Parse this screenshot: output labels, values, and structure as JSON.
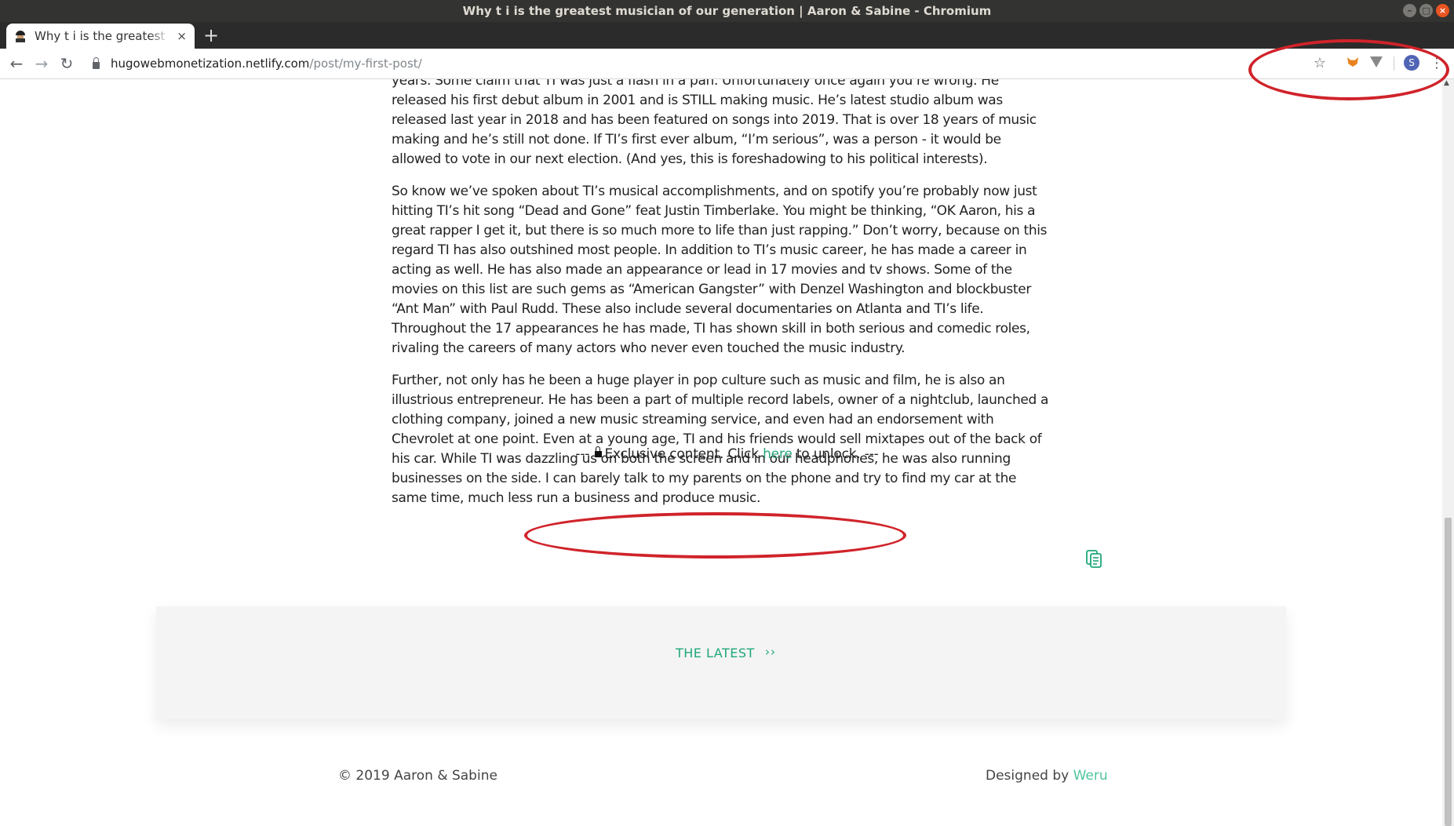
{
  "window": {
    "title": "Why t i is the greatest musician of our generation | Aaron & Sabine - Chromium",
    "controls": [
      "–",
      "□",
      "×"
    ]
  },
  "tab": {
    "title": "Why t i is the greatest musician of our generation | Aaron & Sabine",
    "close": "×",
    "new_tab": "+"
  },
  "toolbar": {
    "back": "←",
    "forward": "→",
    "reload": "↻",
    "url_host": "hugowebmonetization.netlify.com",
    "url_path": "/post/my-first-post/",
    "bookmark_star": "☆",
    "profile_initial": "S",
    "menu": "⋮"
  },
  "article": {
    "paragraphs": [
      "years. Some claim that TI was just a flash in a pan. Unfortunately once again you’re wrong. He released his first debut album in 2001 and is STILL making music. He’s latest studio album was released last year in 2018 and has been featured on songs into 2019. That is over 18 years of music making and he’s still not done. If TI’s first ever album, “I’m serious”, was a person - it would be allowed to vote in our next election. (And yes, this is foreshadowing to his political interests).",
      "So know we’ve spoken about TI’s musical accomplishments, and on spotify you’re probably now just hitting TI’s hit song “Dead and Gone” feat Justin Timberlake. You might be thinking, “OK Aaron, his a great rapper I get it, but there is so much more to life than just rapping.” Don’t worry, because on this regard TI has also outshined most people. In addition to TI’s music career, he has made a career in acting as well. He has also made an appearance or lead in 17 movies and tv shows. Some of the movies on this list are such gems as “American Gangster” with Denzel Washington and blockbuster “Ant Man” with Paul Rudd. These also include several documentaries on Atlanta and TI’s life. Throughout the 17 appearances he has made, TI has shown skill in both serious and comedic roles, rivaling the careers of many actors who never even touched the music industry.",
      "Further, not only has he been a huge player in pop culture such as music and film, he is also an illustrious entrepreneur. He has been a part of multiple record labels, owner of a nightclub, launched a clothing company, joined a new music streaming service, and even had an endorsement with Chevrolet at one point. Even at a young age, TI and his friends would sell mixtapes out of the back of his car. While TI was dazzling us on both the screen and in our headphones, he was also running businesses on the side. I can barely talk to my parents on the phone and try to find my car at the same time, much less run a business and produce music."
    ]
  },
  "exclusive": {
    "prefix": "---",
    "text_before": "Exclusive content. Click",
    "link": "here",
    "text_after": "to unlock. ---"
  },
  "latest": {
    "label": "THE LATEST",
    "arrows": "››"
  },
  "footer": {
    "copyright": "© 2019 Aaron & Sabine",
    "designed_by": "Designed by",
    "designer": "Weru"
  },
  "colors": {
    "accent_green": "#1ea77a",
    "annotation_red": "#d0232a"
  }
}
